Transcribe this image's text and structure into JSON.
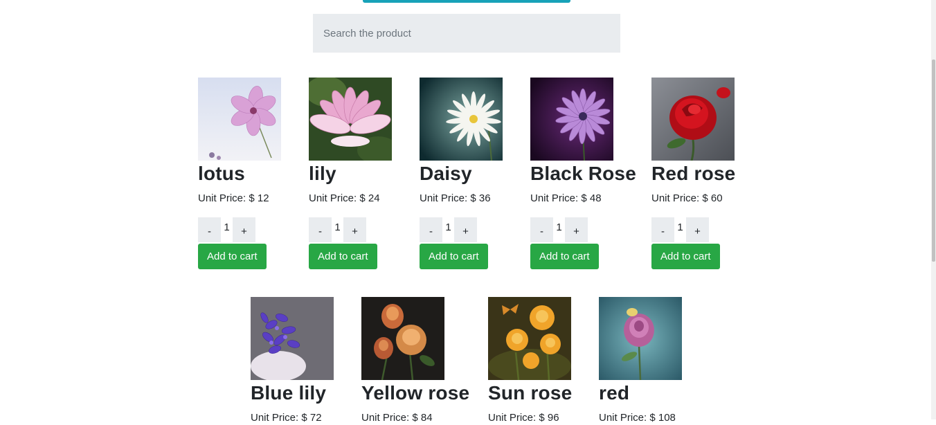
{
  "search": {
    "placeholder": "Search the product"
  },
  "products": [
    {
      "name": "lotus",
      "price": "Unit Price: $ 12",
      "qty": "1",
      "minus": "-",
      "plus": "+",
      "add_label": "Add to cart"
    },
    {
      "name": "lily",
      "price": "Unit Price: $ 24",
      "qty": "1",
      "minus": "-",
      "plus": "+",
      "add_label": "Add to cart"
    },
    {
      "name": "Daisy",
      "price": "Unit Price: $ 36",
      "qty": "1",
      "minus": "-",
      "plus": "+",
      "add_label": "Add to cart"
    },
    {
      "name": "Black Rose",
      "price": "Unit Price: $ 48",
      "qty": "1",
      "minus": "-",
      "plus": "+",
      "add_label": "Add to cart"
    },
    {
      "name": "Red rose",
      "price": "Unit Price: $ 60",
      "qty": "1",
      "minus": "-",
      "plus": "+",
      "add_label": "Add to cart"
    },
    {
      "name": "Blue lily",
      "price": "Unit Price: $ 72"
    },
    {
      "name": "Yellow rose",
      "price": "Unit Price: $ 84"
    },
    {
      "name": "Sun rose",
      "price": "Unit Price: $ 96"
    },
    {
      "name": "red",
      "price": "Unit Price: $ 108"
    }
  ],
  "colors": {
    "accent": "#17a2b8",
    "add_button": "#28a745",
    "search_bg": "#e9ecef"
  }
}
